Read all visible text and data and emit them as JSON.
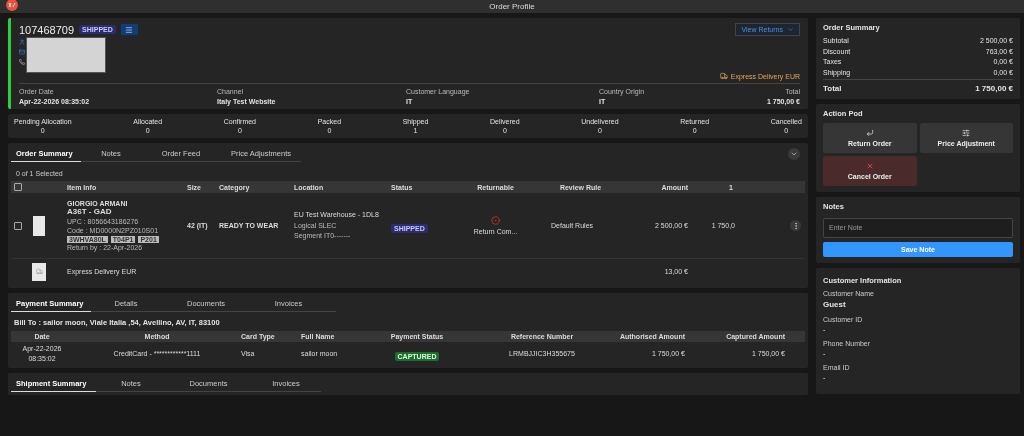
{
  "header": {
    "title": "Order Profile"
  },
  "order": {
    "number": "107468709",
    "status": "SHIPPED",
    "view_returns": "View Returns",
    "delivery": "Express Delivery EUR",
    "fields": [
      {
        "label": "Order Date",
        "value": "Apr-22-2026 08:35:02"
      },
      {
        "label": "Channel",
        "value": "Italy Test Website"
      },
      {
        "label": "Customer Language",
        "value": "IT"
      },
      {
        "label": "Country Origin",
        "value": "IT"
      },
      {
        "label": "Total",
        "value": "1 750,00 €"
      }
    ]
  },
  "status_counts": [
    {
      "label": "Pending Allocation",
      "value": "0"
    },
    {
      "label": "Allocated",
      "value": "0"
    },
    {
      "label": "Confirmed",
      "value": "0"
    },
    {
      "label": "Packed",
      "value": "0"
    },
    {
      "label": "Shipped",
      "value": "1"
    },
    {
      "label": "Delivered",
      "value": "0"
    },
    {
      "label": "Undelivered",
      "value": "0"
    },
    {
      "label": "Returned",
      "value": "0"
    },
    {
      "label": "Cancelled",
      "value": "0"
    }
  ],
  "order_tabs": [
    {
      "label": "Order Summary",
      "selected": true
    },
    {
      "label": "Notes",
      "selected": false
    },
    {
      "label": "Order Feed",
      "selected": false
    },
    {
      "label": "Price Adjustments",
      "selected": false
    }
  ],
  "selection_count": "0 of 1 Selected",
  "items_table": {
    "select_all_checked": false,
    "columns": [
      "Item Info",
      "Size",
      "Category",
      "Location",
      "Status",
      "Returnable",
      "Review Rule",
      "Amount",
      "1"
    ],
    "rows": [
      {
        "kind": "product",
        "checked": false,
        "brand": "GIORGIO ARMANI",
        "name": "A36T - GAD",
        "upc": "UPC : 8056643186276",
        "code": "Code : MD0000N2PZ010S01",
        "tags": [
          "3WHVA80L",
          "T04P1",
          "P201"
        ],
        "return_by": "Return by : 22-Apr-2026",
        "size": "42 (IT)",
        "category": "READY TO WEAR",
        "location": "EU Test Warehouse - 1DL8",
        "logical": "Logical SLEC",
        "segment": "Segment IT0-------",
        "status": "SHIPPED",
        "returnable": "Return Com...",
        "review_rule": "Default Rules",
        "amount": "2 500,00 €",
        "column_9": "1 750,0"
      },
      {
        "kind": "shipping",
        "name": "Express Delivery EUR",
        "amount": "13,00 €"
      }
    ]
  },
  "payment_tabs": [
    {
      "label": "Payment Summary",
      "selected": true
    },
    {
      "label": "Details",
      "selected": false
    },
    {
      "label": "Documents",
      "selected": false
    },
    {
      "label": "Invoices",
      "selected": false
    }
  ],
  "bill_to": "Bill To : sailor moon, Viale Italia ,54, Avellino, AV, IT, 83100",
  "payments_table": {
    "columns": [
      "Date",
      "Method",
      "Card Type",
      "Full Name",
      "Payment Status",
      "Reference Number",
      "Authorised Amount",
      "Captured Amount"
    ],
    "rows": [
      {
        "date": "Apr-22-2026",
        "time": "08:35:02",
        "method": "CreditCard - ************1111",
        "card_type": "Visa",
        "full_name": "sailor moon",
        "status": "CAPTURED",
        "reference": "LRMBJJIC3H355675",
        "authorised": "1 750,00 €",
        "captured": "1 750,00 €"
      }
    ]
  },
  "shipment_tabs": [
    {
      "label": "Shipment Summary",
      "selected": true
    },
    {
      "label": "Notes",
      "selected": false
    },
    {
      "label": "Documents",
      "selected": false
    },
    {
      "label": "Invoices",
      "selected": false
    }
  ],
  "summary": {
    "title": "Order Summary",
    "rows": [
      {
        "label": "Subtotal",
        "value": "2 500,00 €"
      },
      {
        "label": "Discount",
        "value": "763,00 €"
      },
      {
        "label": "Taxes",
        "value": "0,00 €"
      },
      {
        "label": "Shipping",
        "value": "0,00 €"
      }
    ],
    "total_label": "Total",
    "total_value": "1 750,00 €"
  },
  "action_pod": {
    "title": "Action Pod",
    "actions": [
      {
        "kind": "return",
        "label": "Return Order"
      },
      {
        "kind": "adjust",
        "label": "Price Adjustment"
      },
      {
        "kind": "cancel",
        "label": "Cancel Order"
      }
    ]
  },
  "notes": {
    "title": "Notes",
    "placeholder": "Enter Note",
    "button": "Save Note"
  },
  "customer": {
    "title": "Customer Information",
    "fields": [
      {
        "label": "Customer Name",
        "value": "Guest"
      },
      {
        "label": "Customer ID",
        "value": "-"
      },
      {
        "label": "Phone Number",
        "value": "-"
      },
      {
        "label": "Email ID",
        "value": "-"
      }
    ]
  }
}
